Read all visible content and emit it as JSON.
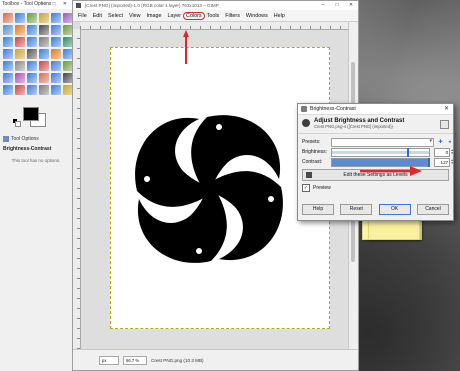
{
  "toolbox": {
    "title": "Toolbox - Tool Options",
    "controls": "─ □ ✕",
    "tool_options_tab": "Tool Options",
    "tool_name": "Brightness-Contrast",
    "tool_message": "This tool has no options.",
    "tools": [
      "#d46a4c",
      "#3b7dd8",
      "#6a9a3a",
      "#c9a12b",
      "#3b7dd8",
      "#9b59b6",
      "#4a8fd0",
      "#e07a1f",
      "#3b7dd8",
      "#4a4a4a",
      "#3b7dd8",
      "#6a9a3a",
      "#3b7dd8",
      "#c44",
      "#3b7dd8",
      "#7a7a7a",
      "#3b7dd8",
      "#2b8a6a",
      "#3b7dd8",
      "#c9a12b",
      "#555",
      "#3b7dd8",
      "#e07a1f",
      "#3b7dd8",
      "#3b7dd8",
      "#888",
      "#3b7dd8",
      "#c44",
      "#3b7dd8",
      "#6a9a3a",
      "#3b7dd8",
      "#b04ab0",
      "#3b7dd8",
      "#d46a4c",
      "#3b7dd8",
      "#444",
      "#3b7dd8",
      "#c44",
      "#3b7dd8",
      "#7a7a7a",
      "#3b7dd8",
      "#c9a12b"
    ]
  },
  "gimp": {
    "title": "[Crest PNG] (imported)-1.0 (RGB color 1 layer) 763x1013 – GIMP",
    "controls": [
      "─",
      "□",
      "✕"
    ],
    "menus": [
      "File",
      "Edit",
      "Select",
      "View",
      "Image",
      "Layer",
      "Colors",
      "Tools",
      "Filters",
      "Windows",
      "Help"
    ],
    "highlighted_menu": "Colors",
    "status": {
      "unit": "px",
      "zoom": "66.7 %",
      "text": "Crest PNG.png (10.3 MB)"
    }
  },
  "dialog": {
    "title": "Brightness-Contrast",
    "close": "✕",
    "heading": "Adjust Brightness and Contrast",
    "subheading": "Crest PNG.png-4 ([Crest PNG] (imported))",
    "presets_label": "Presets:",
    "brightness_label": "Brightness:",
    "brightness_value": "0",
    "contrast_label": "Contrast:",
    "contrast_value": "127",
    "levels_button": "Edit these Settings as Levels",
    "preview_label": "Preview",
    "preview_checked": true,
    "buttons": {
      "help": "Help",
      "reset": "Reset",
      "ok": "OK",
      "cancel": "Cancel"
    },
    "accent_color": "#2d6bd0"
  },
  "annotation_color": "#e0282c"
}
